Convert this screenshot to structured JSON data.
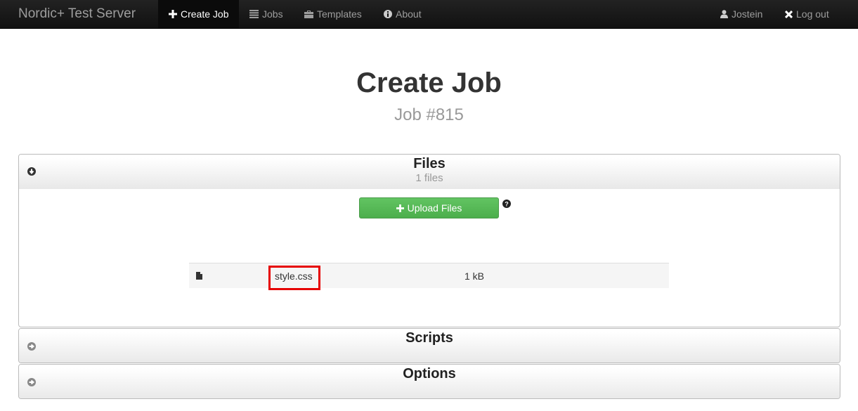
{
  "navbar": {
    "brand": "Nordic+ Test Server",
    "items": [
      {
        "label": "Create Job",
        "icon": "plus-icon",
        "active": true
      },
      {
        "label": "Jobs",
        "icon": "list-icon",
        "active": false
      },
      {
        "label": "Templates",
        "icon": "briefcase-icon",
        "active": false
      },
      {
        "label": "About",
        "icon": "info-icon",
        "active": false
      }
    ],
    "right": [
      {
        "label": "Jostein",
        "icon": "user-icon"
      },
      {
        "label": "Log out",
        "icon": "close-icon"
      }
    ]
  },
  "page": {
    "title": "Create Job",
    "subtitle": "Job #815"
  },
  "panels": {
    "files": {
      "title": "Files",
      "subtitle": "1 files",
      "expanded": true,
      "upload_label": "Upload Files",
      "files": [
        {
          "name": "style.css",
          "size": "1 kB",
          "icon": "file-icon"
        }
      ]
    },
    "scripts": {
      "title": "Scripts",
      "expanded": false
    },
    "options": {
      "title": "Options",
      "expanded": false
    }
  },
  "colors": {
    "navbar_bg": "#1b1b1b",
    "upload_green": "#5cb85c",
    "highlight_red": "#e60000"
  }
}
